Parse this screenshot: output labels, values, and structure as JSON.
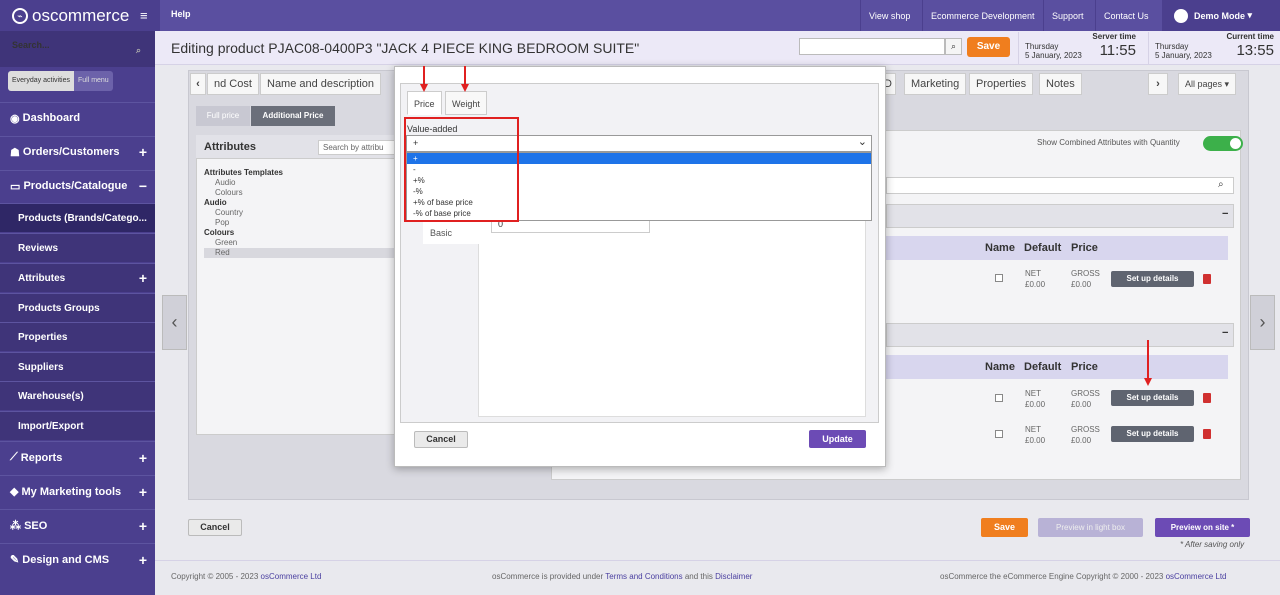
{
  "topbar": {
    "logo": "oscommerce",
    "help": "Help",
    "nav": [
      "View shop",
      "Ecommerce Development",
      "Support",
      "Contact Us"
    ],
    "user": "Demo Mode"
  },
  "sidebar": {
    "search_placeholder": "Search...",
    "tab_everyday": "Everyday activities",
    "tab_full": "Full menu",
    "items": [
      "Dashboard",
      "Orders/Customers",
      "Products/Catalogue"
    ],
    "sub_items": [
      "Products (Brands/Catego...",
      "Reviews",
      "Attributes",
      "Products Groups",
      "Properties",
      "Suppliers",
      "Warehouse(s)",
      "Import/Export"
    ],
    "items2": [
      "Reports",
      "My Marketing tools",
      "SEO",
      "Design and CMS"
    ]
  },
  "header": {
    "title": "Editing product PJAC08-0400P3 \"JACK 4 PIECE KING BEDROOM SUITE\"",
    "save": "Save",
    "server_label": "Server time",
    "server_day": "Thursday",
    "server_date": "5 January, 2023",
    "server_time": "11:55",
    "current_label": "Current time",
    "current_day": "Thursday",
    "current_date": "5 January, 2023",
    "current_time": "13:55"
  },
  "tabs": [
    "nd Cost",
    "Name and description",
    "D",
    "Marketing",
    "Properties",
    "Notes"
  ],
  "all_pages": "All pages",
  "price_toggle": {
    "full": "Full price",
    "additional": "Additional Price"
  },
  "attributes": {
    "title": "Attributes",
    "search_placeholder": "Search by attribu",
    "tree": [
      {
        "label": "Attributes Templates",
        "bold": true
      },
      {
        "label": "Audio",
        "bold": false
      },
      {
        "label": "Colours",
        "bold": false
      },
      {
        "label": "Audio",
        "bold": true
      },
      {
        "label": "Country",
        "bold": false
      },
      {
        "label": "Pop",
        "bold": false
      },
      {
        "label": "Colours",
        "bold": true
      },
      {
        "label": "Green",
        "bold": false
      },
      {
        "label": "Red",
        "bold": false
      }
    ]
  },
  "right": {
    "combined": "Show Combined Attributes with Quantity",
    "col_name": "Name",
    "col_default": "Default",
    "col_price": "Price",
    "net": "NET",
    "gross": "GROSS",
    "net_val": "£0.00",
    "gross_val": "£0.00",
    "setup": "Set up details"
  },
  "modal": {
    "tab_price": "Price",
    "tab_weight": "Weight",
    "value_label": "Value-added",
    "selected": "+",
    "options": [
      "+",
      "-",
      "+%",
      "-%",
      "+% of base price",
      "-% of base price"
    ],
    "basic": "Basic",
    "input_value": "0",
    "cancel": "Cancel",
    "update": "Update"
  },
  "bottom": {
    "cancel": "Cancel",
    "save": "Save",
    "preview_lightbox": "Preview in light box",
    "preview_site": "Preview on site *",
    "note": "* After saving only"
  },
  "footer": {
    "copyright": "Copyright © 2005 - 2023",
    "copyright_link": "osCommerce Ltd",
    "terms_pre": "osCommerce is provided under",
    "terms_link": "Terms and Conditions",
    "terms_mid": "and this",
    "disclaimer": "Disclaimer",
    "engine": "osCommerce the eCommerce Engine Copyright © 2000 - 2023",
    "engine_link": "osCommerce Ltd"
  },
  "colors": {
    "brand": "#5a4fa0",
    "save": "#f07e1e",
    "update": "#6c4bb5",
    "highlight": "#e02020",
    "selected_option": "#1e73e8"
  }
}
